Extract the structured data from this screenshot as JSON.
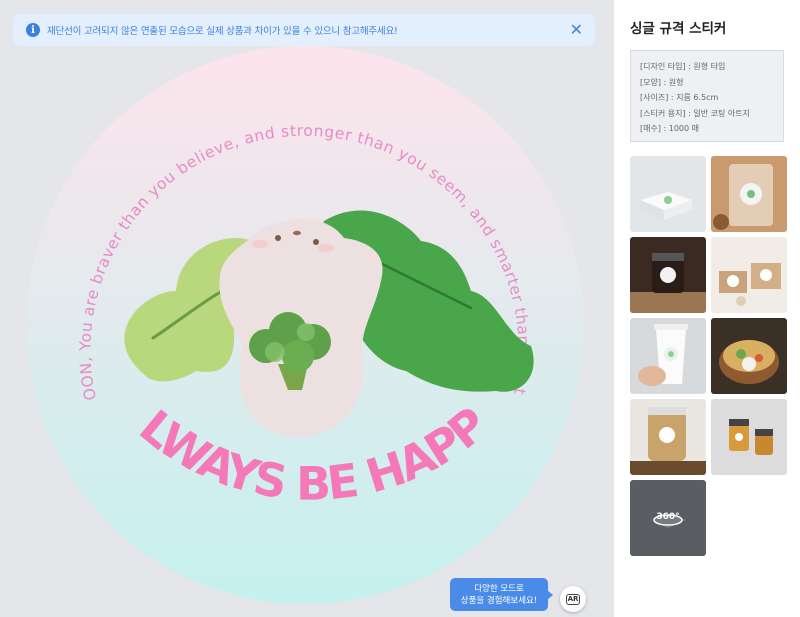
{
  "notice": {
    "message": "재단선이 고려되지 않은 연출된 모습으로 실제 상품과 차이가 있을 수 있으니 참고해주세요!",
    "icon": "info-icon",
    "close_icon": "close-icon"
  },
  "sticker": {
    "arc_text": "SE YOON, You are braver than you believe, and stronger than you seem, and smarter than you think.",
    "headline": "ALWAYS BE HAPPY",
    "gradient_top": "#fde4ec",
    "gradient_bottom": "#c4f1ee",
    "headline_color": "#f578b8",
    "arc_color": "#e88ac6"
  },
  "tooltip": {
    "line1": "다양한 모드로",
    "line2": "상품을 경험해보세요!"
  },
  "ar_button": {
    "label": "AR"
  },
  "panel": {
    "title": "싱글 규격 스티커",
    "specs": [
      "[디자인 타입] : 원형 타입",
      "[모양] : 원형",
      "[사이즈] : 지름 6.5cm",
      "[스티커 용지] : 일반 코팅 아트지",
      "[매수] : 1000 매"
    ],
    "thumbnails": [
      {
        "name": "thumb-box-mockup"
      },
      {
        "name": "thumb-cookie-bag"
      },
      {
        "name": "thumb-jar-table"
      },
      {
        "name": "thumb-gift-boxes"
      },
      {
        "name": "thumb-coffee-cup"
      },
      {
        "name": "thumb-food-bowl"
      },
      {
        "name": "thumb-snack-jar"
      },
      {
        "name": "thumb-honey-jars"
      },
      {
        "name": "thumb-360-view",
        "label": "360°"
      }
    ]
  }
}
